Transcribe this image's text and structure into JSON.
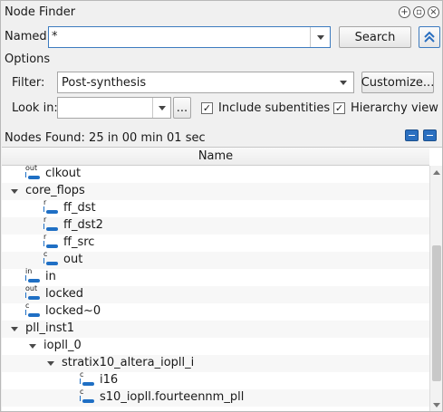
{
  "window": {
    "title": "Node Finder"
  },
  "named": {
    "label": "Named:",
    "value": "*",
    "search_label": "Search"
  },
  "options": {
    "heading": "Options",
    "filter_label": "Filter:",
    "filter_value": "Post-synthesis",
    "customize_label": "Customize...",
    "lookin_label": "Look in:",
    "lookin_value": "",
    "browse_label": "...",
    "include_subentities_label": "Include subentities",
    "include_subentities_checked": "✓",
    "hierarchy_view_label": "Hierarchy view",
    "hierarchy_view_checked": "✓"
  },
  "status": {
    "text": "Nodes Found: 25 in 00 min 01 sec"
  },
  "table": {
    "column_name": "Name",
    "rows": [
      {
        "label": "clkout",
        "pin": "out",
        "expander": false
      },
      {
        "label": "core_flops",
        "pin": "",
        "expander": true
      },
      {
        "label": "ff_dst",
        "pin": "r",
        "expander": false
      },
      {
        "label": "ff_dst2",
        "pin": "r",
        "expander": false
      },
      {
        "label": "ff_src",
        "pin": "r",
        "expander": false
      },
      {
        "label": "out",
        "pin": "c",
        "expander": false
      },
      {
        "label": "in",
        "pin": "in",
        "expander": false
      },
      {
        "label": "locked",
        "pin": "out",
        "expander": false
      },
      {
        "label": "locked~0",
        "pin": "c",
        "expander": false
      },
      {
        "label": "pll_inst1",
        "pin": "",
        "expander": true
      },
      {
        "label": "iopll_0",
        "pin": "",
        "expander": true
      },
      {
        "label": "stratix10_altera_iopll_i",
        "pin": "",
        "expander": true
      },
      {
        "label": "i16",
        "pin": "c",
        "expander": false
      },
      {
        "label": "s10_iopll.fourteennm_pll",
        "pin": "c",
        "expander": false
      }
    ]
  },
  "icons": {
    "help": "help-circle-icon",
    "float": "float-window-icon",
    "close": "close-window-icon",
    "collapse_options": "double-chevron-up-icon",
    "expand_all": "expand-all-icon",
    "collapse_all": "collapse-all-icon"
  },
  "colors": {
    "accent": "#2a6fc0",
    "pin": "#1f6fc4"
  }
}
